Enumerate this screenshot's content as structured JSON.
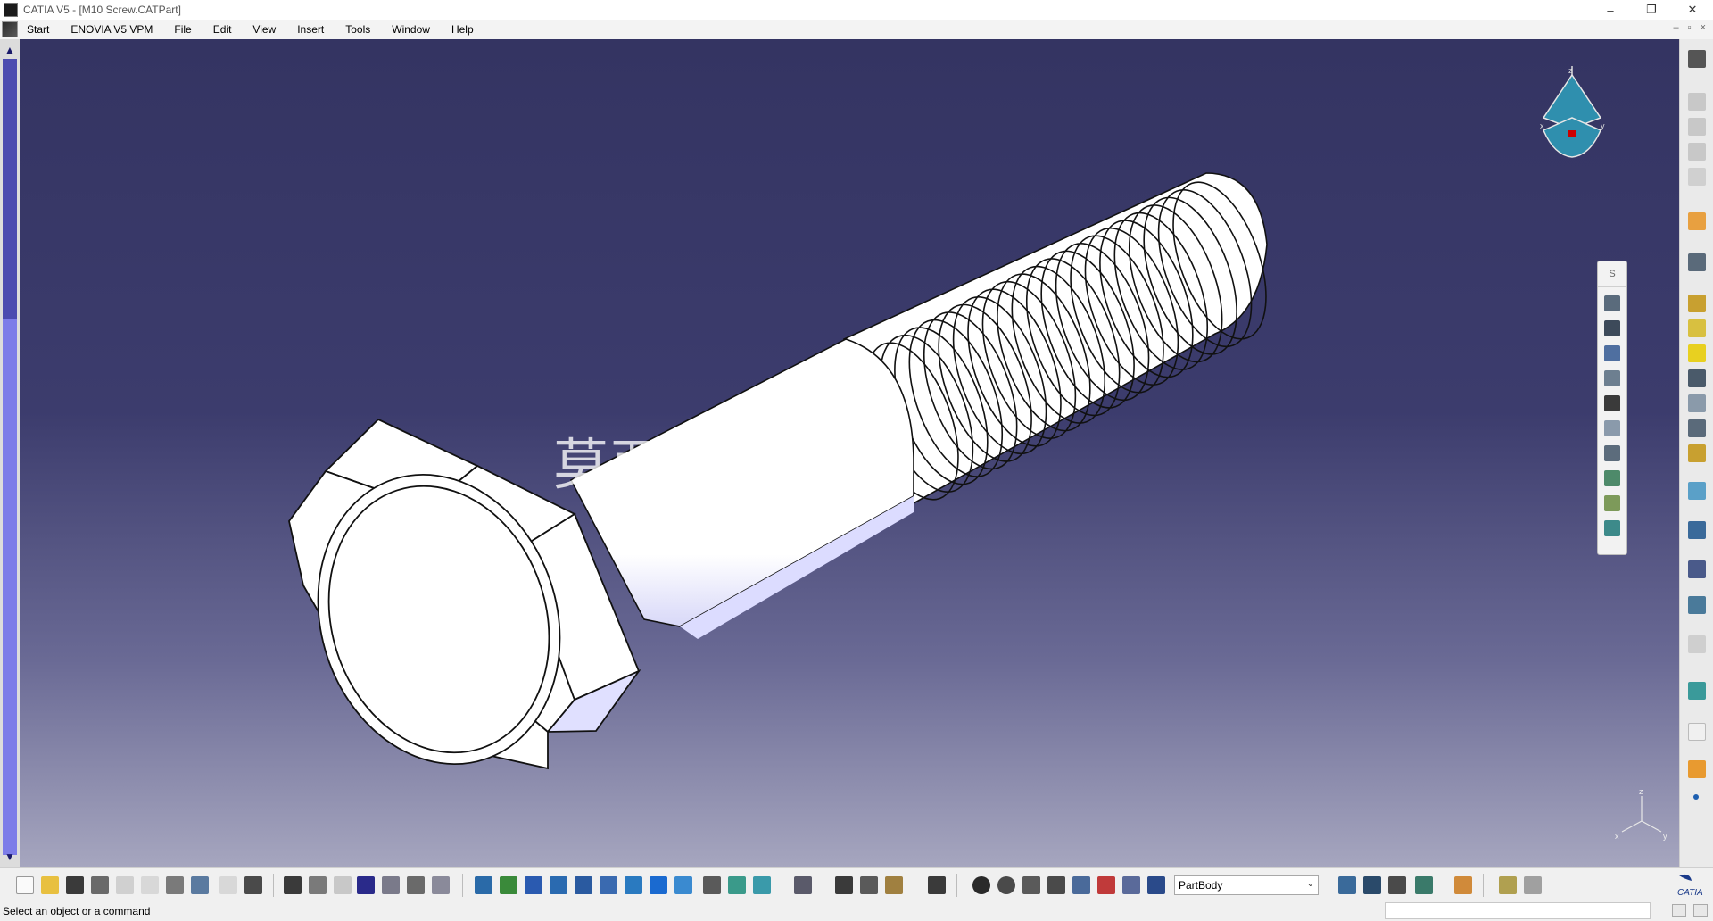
{
  "window": {
    "title": "CATIA V5 - [M10 Screw.CATPart]",
    "controls": [
      "–",
      "❐",
      "✕"
    ]
  },
  "menu": {
    "items": [
      "Start",
      "ENOVIA V5 VPM",
      "File",
      "Edit",
      "View",
      "Insert",
      "Tools",
      "Window",
      "Help"
    ],
    "mdi_controls": [
      "–",
      "▫",
      "×"
    ]
  },
  "viewport": {
    "background_top": "#343462",
    "background_bottom": "#a6a6bf",
    "watermark": "莫西 .com",
    "compass_axis_labels": [
      "z",
      "x",
      "y"
    ],
    "triad_labels": [
      "z",
      "x",
      "y"
    ]
  },
  "floating_toolbar": {
    "header": "S",
    "icons": [
      "reference-element-icon",
      "plane-icon",
      "extrude-icon",
      "pocket-icon",
      "hole-icon",
      "rib-icon",
      "slot-icon",
      "solid-icon",
      "sketch-based-icon",
      "multi-section-icon"
    ]
  },
  "right_toolbar": {
    "icons": [
      "gear-icon",
      "sketch-icon",
      "pad-icon",
      "pocket-icon",
      "shaft-icon",
      "groove-icon",
      "hole-icon",
      "rib-icon",
      "fillet-icon",
      "chamfer-icon",
      "draft-icon",
      "shell-icon",
      "thickness-icon",
      "thread-icon",
      "mirror-icon",
      "pattern-icon",
      "scaling-icon",
      "annotation-icon",
      "text-icon",
      "measure-icon",
      "point-icon"
    ]
  },
  "bottom_toolbar": {
    "part_body_select": "PartBody",
    "logo_text": "CATIA"
  },
  "status": {
    "text": "Select an object or a command"
  }
}
